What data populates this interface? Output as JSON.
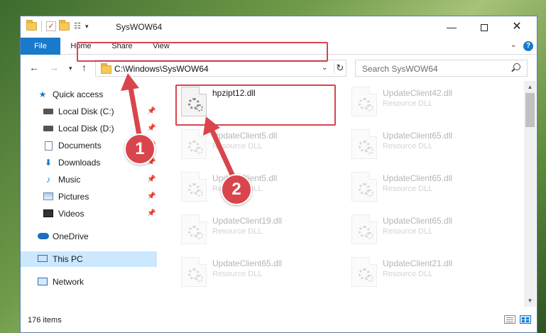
{
  "window": {
    "title": "SysWOW64",
    "controls": {
      "minimize": "—",
      "maximize": "",
      "close": "✕"
    }
  },
  "ribbon": {
    "tabs": [
      {
        "label": "File"
      },
      {
        "label": "Home"
      },
      {
        "label": "Share"
      },
      {
        "label": "View"
      }
    ],
    "help": "?"
  },
  "navigation": {
    "back": "←",
    "forward": "→",
    "recent": "▾",
    "up": "↑",
    "address": "C:\\Windows\\SysWOW64",
    "search_placeholder": "Search SysWOW64"
  },
  "sidebar": {
    "items": [
      {
        "label": "Quick access",
        "icon": "star-icon",
        "pinned": false
      },
      {
        "label": "Local Disk (C:)",
        "icon": "drive-icon",
        "pinned": true
      },
      {
        "label": "Local Disk (D:)",
        "icon": "drive-icon",
        "pinned": true
      },
      {
        "label": "Documents",
        "icon": "document-icon",
        "pinned": true
      },
      {
        "label": "Downloads",
        "icon": "download-icon",
        "pinned": true
      },
      {
        "label": "Music",
        "icon": "music-icon",
        "pinned": true
      },
      {
        "label": "Pictures",
        "icon": "pictures-icon",
        "pinned": true
      },
      {
        "label": "Videos",
        "icon": "videos-icon",
        "pinned": true
      },
      {
        "label": "OneDrive",
        "icon": "cloud-icon",
        "pinned": false
      },
      {
        "label": "This PC",
        "icon": "computer-icon",
        "pinned": false,
        "selected": true
      },
      {
        "label": "Network",
        "icon": "network-icon",
        "pinned": false
      }
    ],
    "pin_glyph": "📌"
  },
  "files": [
    {
      "name": "hpzipt12.dll",
      "type": "",
      "highlighted": true
    },
    {
      "name": "UpdateClient42.dll",
      "type": "Resource DLL"
    },
    {
      "name": "UpdateClient5.dll",
      "type": "Resource DLL"
    },
    {
      "name": "UpdateClient65.dll",
      "type": "Resource DLL"
    },
    {
      "name": "UpdateClient5.dll",
      "type": "Resource DLL"
    },
    {
      "name": "UpdateClient65.dll",
      "type": "Resource DLL"
    },
    {
      "name": "UpdateClient19.dll",
      "type": "Resource DLL"
    },
    {
      "name": "UpdateClient65.dll",
      "type": "Resource DLL"
    },
    {
      "name": "UpdateClient65.dll",
      "type": "Resource DLL"
    },
    {
      "name": "UpdateClient21.dll",
      "type": "Resource DLL"
    }
  ],
  "status": {
    "item_count": "176 items"
  },
  "annotations": {
    "step1": "1",
    "step2": "2",
    "color": "#d9454c"
  },
  "colors": {
    "accent": "#1979ca",
    "selection": "#cce8ff",
    "annotation": "#d9454c"
  }
}
